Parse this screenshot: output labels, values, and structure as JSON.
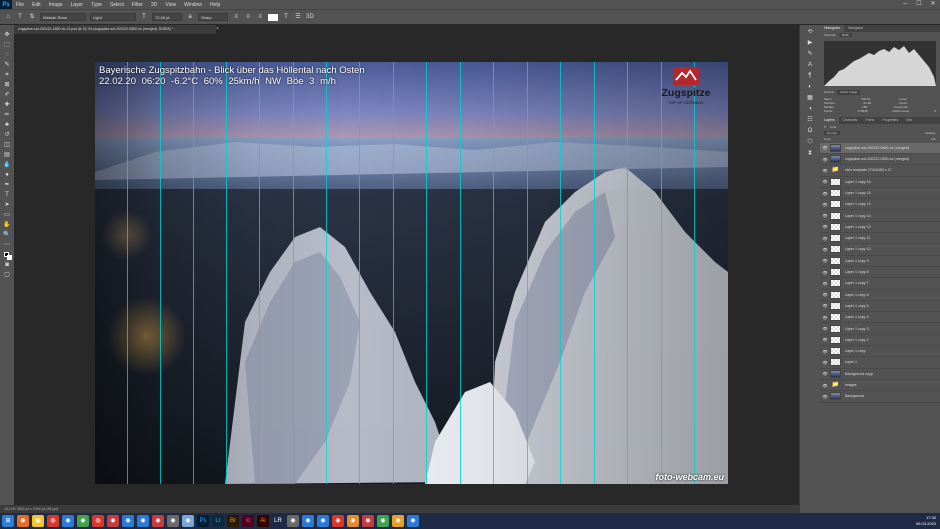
{
  "menubar": {
    "app_icon": "Ps",
    "items": [
      "File",
      "Edit",
      "Image",
      "Layer",
      "Type",
      "Select",
      "Filter",
      "3D",
      "View",
      "Window",
      "Help"
    ],
    "window_controls": [
      "–",
      "☐",
      "✕"
    ]
  },
  "options": {
    "tool_icon": "T",
    "font_family": "Weblab Raus",
    "font_style": "Light",
    "font_size": "72,46 pt",
    "antialias": "Sharp"
  },
  "document": {
    "tab_title": "zugspitze-sot-200222-1890-hc-01.psd @ 15,1% (zugspitze-sot-200222-0550-hc (merged), RGB/8) *",
    "status": "15,10%    3500 px x 2400 px (96 ppi)"
  },
  "image": {
    "caption_line1": "Bayerische Zugspitzbahn - Blick über das Höllental nach Osten",
    "caption_line2": "22.02.20 06:20   -6.2°C   60%   25km/h NW   Böe 3 m/h",
    "logo_name": "Zugspitze",
    "logo_sub": "TOP OF GERMANY",
    "credit": "foto-webcam.eu"
  },
  "panels": {
    "top_tabs": [
      "Histogram",
      "Navigator"
    ],
    "channel_label": "Channel:",
    "channel_value": "RGB",
    "source_label": "Source:",
    "source_value": "Entire Image",
    "stats": [
      [
        "Mean:",
        "156.60",
        "Level:",
        ""
      ],
      [
        "Std Dev:",
        "62.08",
        "Count:",
        ""
      ],
      [
        "Median:",
        "158",
        "Percentile:",
        ""
      ],
      [
        "Pixels:",
        "279936",
        "Cache Level:",
        "6"
      ]
    ],
    "layers_tabs": [
      "Layers",
      "Channels",
      "Paths",
      "Properties",
      "Info"
    ],
    "kind_label": "Kind",
    "blend_mode": "Normal",
    "opacity": "Opacity:",
    "fill": "Fill:",
    "lock": "Lock:",
    "layers": [
      {
        "name": "zugspitze-sot-200222-0600-hc (merged)",
        "type": "img"
      },
      {
        "name": "zugspitze-sot-200222-0550-hc (merged)",
        "type": "img"
      },
      {
        "name": "slice template 273x3450 x 17",
        "type": "folder"
      },
      {
        "name": "Layer 1 copy 16",
        "type": "layer"
      },
      {
        "name": "Layer 1 copy 15",
        "type": "layer"
      },
      {
        "name": "Layer 1 copy 14",
        "type": "layer"
      },
      {
        "name": "Layer 1 copy 13",
        "type": "layer"
      },
      {
        "name": "Layer 1 copy 12",
        "type": "layer"
      },
      {
        "name": "Layer 1 copy 11",
        "type": "layer"
      },
      {
        "name": "Layer 1 copy 10",
        "type": "layer"
      },
      {
        "name": "Layer 1 copy 9",
        "type": "layer"
      },
      {
        "name": "Layer 1 copy 8",
        "type": "layer"
      },
      {
        "name": "Layer 1 copy 7",
        "type": "layer"
      },
      {
        "name": "Layer 1 copy 6",
        "type": "layer"
      },
      {
        "name": "Layer 1 copy 5",
        "type": "layer"
      },
      {
        "name": "Layer 1 copy 4",
        "type": "layer"
      },
      {
        "name": "Layer 1 copy 3",
        "type": "layer"
      },
      {
        "name": "Layer 1 copy 2",
        "type": "layer"
      },
      {
        "name": "Layer 1 copy",
        "type": "layer"
      },
      {
        "name": "Layer 1",
        "type": "layer"
      },
      {
        "name": "Background copy",
        "type": "img"
      },
      {
        "name": "images",
        "type": "folder"
      },
      {
        "name": "Background",
        "type": "img"
      }
    ]
  },
  "taskbar": {
    "apps": [
      "Ps",
      "Lr",
      "Br",
      "Id",
      "Ai",
      "LR"
    ],
    "time": "17:30",
    "date": "06.03.2020"
  },
  "colors": {
    "ui_dark": "#535353",
    "canvas_bg": "#282828",
    "guide": "#00d2d2",
    "logo_red": "#b3272d"
  }
}
